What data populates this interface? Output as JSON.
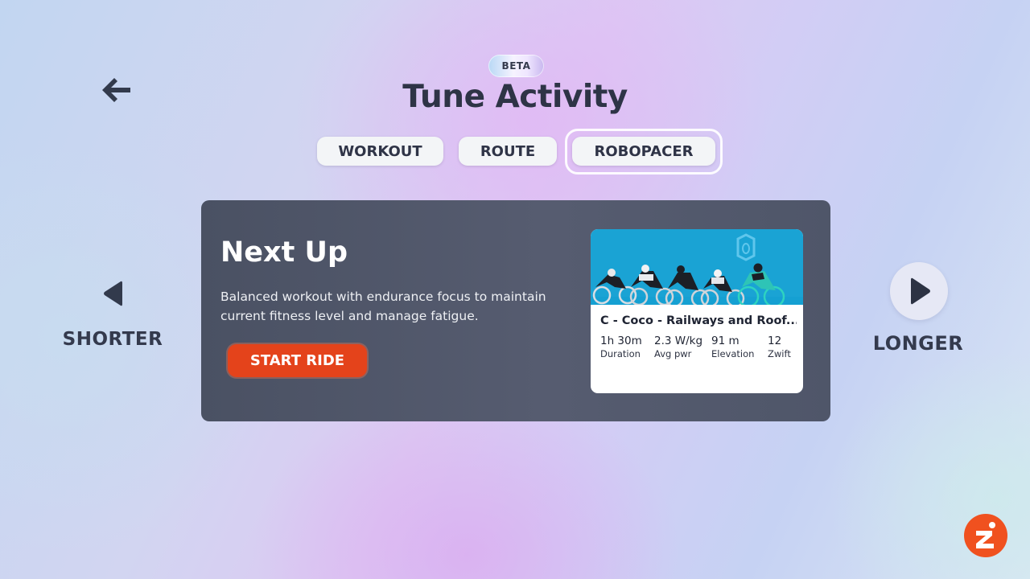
{
  "header": {
    "badge": "BETA",
    "title": "Tune Activity"
  },
  "tabs": [
    {
      "label": "WORKOUT",
      "selected": false
    },
    {
      "label": "ROUTE",
      "selected": false
    },
    {
      "label": "ROBOPACER",
      "selected": true
    }
  ],
  "navigation": {
    "back_icon": "arrow-left-icon",
    "shorter_label": "SHORTER",
    "longer_label": "LONGER"
  },
  "next_up": {
    "title": "Next Up",
    "description": "Balanced workout with endurance focus to maintain current fitness level and manage fatigue.",
    "start_label": "START RIDE",
    "card": {
      "title": "C - Coco - Railways and Roof...",
      "stats": [
        {
          "value": "1h 30m",
          "label": "Duration"
        },
        {
          "value": "2.3 W/kg",
          "label": "Avg pwr"
        },
        {
          "value": "91 m",
          "label": "Elevation"
        },
        {
          "value": "12",
          "label": "Zwift"
        }
      ]
    }
  },
  "colors": {
    "accent": "#e4431b",
    "panel": "#4f5669",
    "card_image_bg": "#1aa3d4"
  }
}
